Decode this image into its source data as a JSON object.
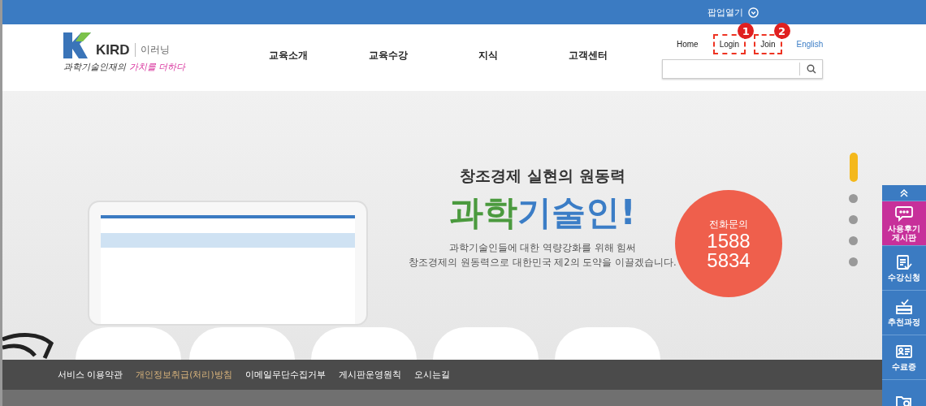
{
  "top_bar": {
    "popup_toggle": "팝업열기"
  },
  "header": {
    "logo": {
      "brand": "KIRD",
      "sub": "이러닝",
      "tagline": "과학기술인재의",
      "tagline_accent": "가치를 더하다"
    },
    "nav": [
      "교육소개",
      "교육수강",
      "지식",
      "고객센터"
    ],
    "links": [
      {
        "label": "Home",
        "kind": "plain"
      },
      {
        "label": "Login",
        "kind": "plain",
        "callout": "1"
      },
      {
        "label": "Join",
        "kind": "plain",
        "callout": "2"
      },
      {
        "label": "English",
        "kind": "lang"
      }
    ]
  },
  "hero": {
    "subtitle": "창조경제 실현의 원동력",
    "title": [
      {
        "text": "과학",
        "color": "#4b9a3e"
      },
      {
        "text": "기술인!",
        "color": "#3b7dc6"
      }
    ],
    "description": [
      "과학기술인들에 대한 역량강화를 위해 힘써",
      "창조경제의 원동력으로 대한민국 제2의 도약을 이끌겠습니다."
    ],
    "call": {
      "label": "전화문의",
      "number": [
        "1588",
        "5834"
      ]
    },
    "slides": [
      {
        "selected": true
      },
      {
        "selected": false
      },
      {
        "selected": false
      },
      {
        "selected": false
      },
      {
        "selected": false
      }
    ]
  },
  "quick_menu": [
    {
      "kind": "chat",
      "label": "사용후기\n게시판",
      "selected": true
    },
    {
      "kind": "clipboard",
      "label": "수강신청",
      "selected": false
    },
    {
      "kind": "list",
      "label": "추천과정",
      "selected": false
    },
    {
      "kind": "card",
      "label": "수료증",
      "selected": false
    },
    {
      "kind": "folder",
      "selected": false
    }
  ],
  "footer": [
    {
      "label": "서비스 이용약관",
      "highlighted": false
    },
    {
      "label": "개인정보취급(처리)방침",
      "highlighted": true
    },
    {
      "label": "이메일무단수집거부",
      "highlighted": false
    },
    {
      "label": "게시판운영원칙",
      "highlighted": false
    },
    {
      "label": "오시는길",
      "highlighted": false
    }
  ]
}
